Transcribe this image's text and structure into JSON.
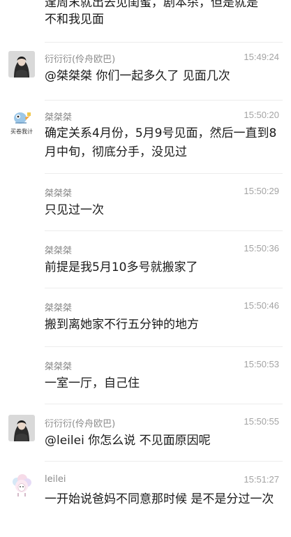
{
  "header_fragment": {
    "line1": "逢周末就出去见闺蜜，剧本杀，但是就是",
    "line2": "不和我见面"
  },
  "messages": [
    {
      "sender": "衍衍衍(伶舟欧巴)",
      "time": "15:49:24",
      "text": "@桀桀桀 你们一起多久了 见面几次",
      "avatar": "dark-haired-woman-avatar"
    },
    {
      "sender": "桀桀桀",
      "time": "15:50:20",
      "text": "确定关系4月份，5月9号见面，然后一直到8月中旬，彻底分手，没见过",
      "avatar": "cartoon-bird-avatar",
      "avatar_caption": "买卷我计"
    },
    {
      "sender": "桀桀桀",
      "time": "15:50:29",
      "text": "只见过一次"
    },
    {
      "sender": "桀桀桀",
      "time": "15:50:36",
      "text": "前提是我5月10多号就搬家了"
    },
    {
      "sender": "桀桀桀",
      "time": "15:50:46",
      "text": "搬到离她家不行五分钟的地方"
    },
    {
      "sender": "桀桀桀",
      "time": "15:50:53",
      "text": "一室一厅，自己住"
    },
    {
      "sender": "衍衍衍(伶舟欧巴)",
      "time": "15:50:55",
      "text": "@leilei 你怎么说 不见面原因呢",
      "avatar": "dark-haired-woman-avatar"
    },
    {
      "sender": "leilei",
      "time": "15:51:27",
      "text": "一开始说爸妈不同意那时候 是不是分过一次",
      "avatar": "pastel-sheep-avatar"
    }
  ]
}
